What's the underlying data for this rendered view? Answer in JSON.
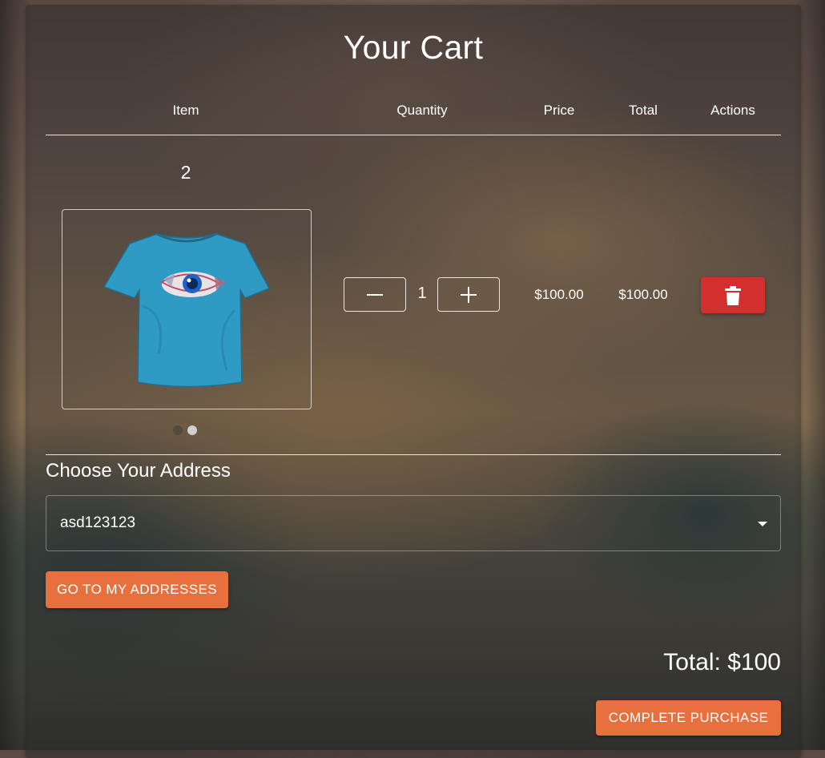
{
  "page": {
    "title": "Your Cart"
  },
  "table": {
    "headers": {
      "item": "Item",
      "quantity": "Quantity",
      "price": "Price",
      "total": "Total",
      "actions": "Actions"
    }
  },
  "cart_item": {
    "id": "2",
    "product_image": "blue-tshirt-with-eye-print",
    "carousel_dots": 2,
    "carousel_active": 2,
    "quantity": "1",
    "price": "$100.00",
    "total": "$100.00",
    "decrement_icon": "minus-icon",
    "increment_icon": "plus-icon",
    "delete_icon": "trash-icon"
  },
  "address": {
    "label": "Choose Your Address",
    "selected": "asd123123",
    "go_button": "GO TO MY ADDRESSES"
  },
  "summary": {
    "total": "Total: $100",
    "purchase_button": "COMPLETE PURCHASE"
  },
  "colors": {
    "accent": "#e8703f",
    "danger": "#d32f2f",
    "tshirt": "#2f9ac3"
  }
}
